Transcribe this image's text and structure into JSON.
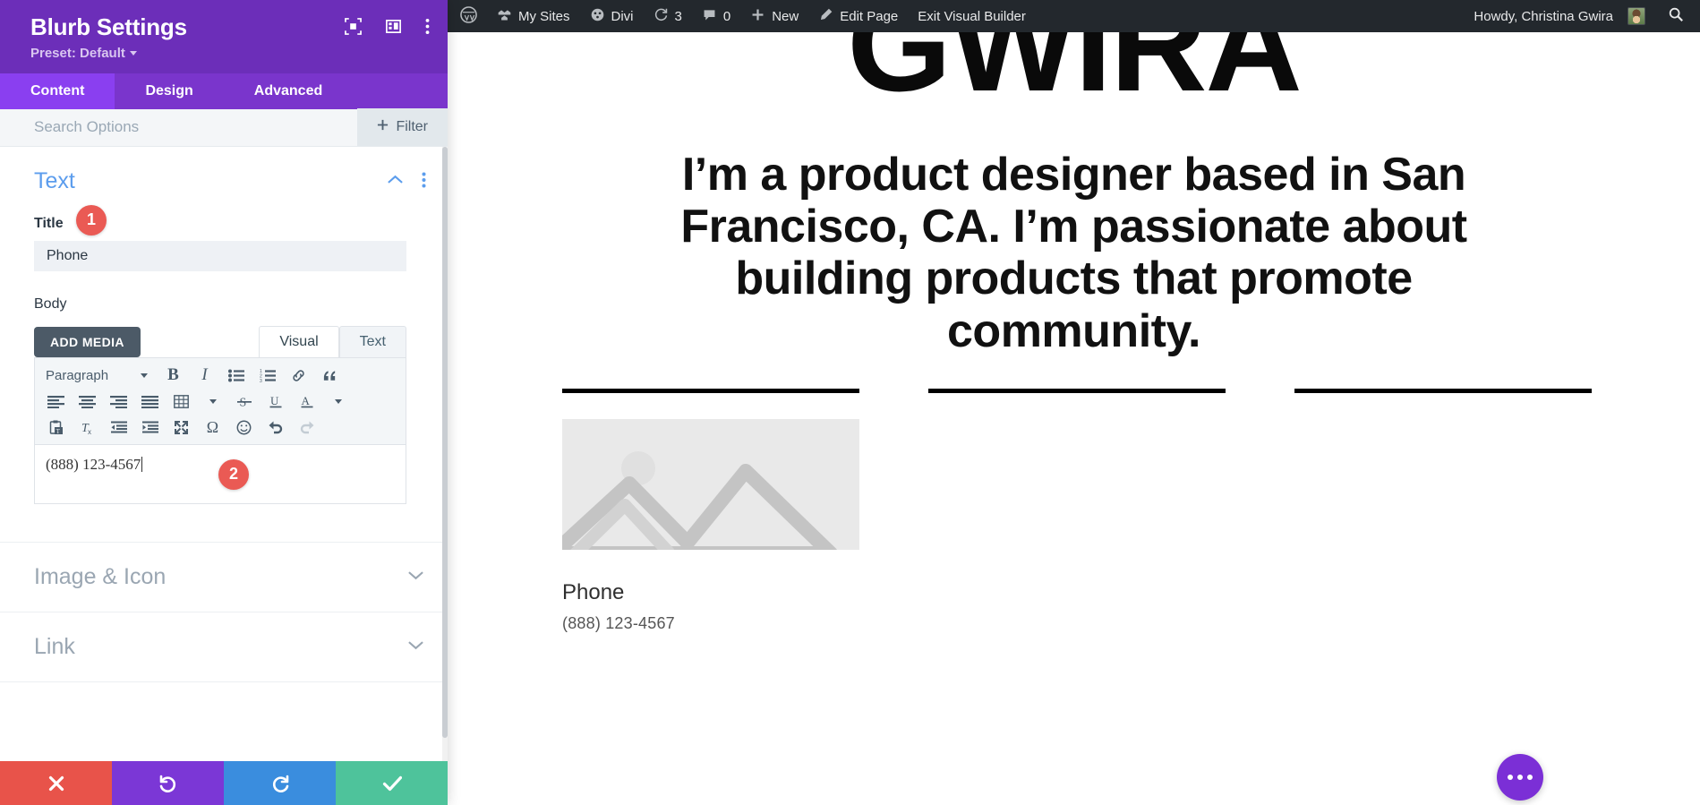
{
  "panel": {
    "title": "Blurb Settings",
    "preset_label": "Preset: Default",
    "header_icons": [
      {
        "name": "focus-target-icon"
      },
      {
        "name": "layout-columns-icon"
      },
      {
        "name": "vertical-dots-icon"
      }
    ],
    "tabs": [
      {
        "label": "Content",
        "active": true
      },
      {
        "label": "Design",
        "active": false
      },
      {
        "label": "Advanced",
        "active": false
      }
    ],
    "search": {
      "placeholder": "Search Options",
      "value": ""
    },
    "filter_button": "Filter",
    "section_text": {
      "title": "Text",
      "title_field": {
        "label": "Title",
        "value": "Phone",
        "callout": "1"
      },
      "body_field": {
        "label": "Body",
        "add_media_button": "ADD MEDIA",
        "editor_tabs": [
          {
            "label": "Visual",
            "active": true
          },
          {
            "label": "Text",
            "active": false
          }
        ],
        "toolbar_row1": [
          {
            "name": "paragraph-format-select",
            "label": "Paragraph"
          },
          {
            "name": "bold-icon",
            "label": "B"
          },
          {
            "name": "italic-icon",
            "label": "I"
          },
          {
            "name": "bullet-list-icon",
            "label": "☰"
          },
          {
            "name": "numbered-list-icon",
            "label": "☰"
          },
          {
            "name": "link-icon",
            "label": "🔗"
          },
          {
            "name": "blockquote-icon",
            "label": "“"
          }
        ],
        "toolbar_row2": [
          {
            "name": "align-left-icon"
          },
          {
            "name": "align-center-icon"
          },
          {
            "name": "align-right-icon"
          },
          {
            "name": "align-justify-icon"
          },
          {
            "name": "table-icon"
          },
          {
            "name": "strikethrough-icon",
            "label": "S"
          },
          {
            "name": "underline-icon",
            "label": "U"
          },
          {
            "name": "text-color-icon",
            "label": "A"
          }
        ],
        "toolbar_row3": [
          {
            "name": "paste-as-text-icon"
          },
          {
            "name": "clear-formatting-icon"
          },
          {
            "name": "outdent-icon"
          },
          {
            "name": "indent-icon"
          },
          {
            "name": "fullscreen-icon"
          },
          {
            "name": "special-character-icon",
            "label": "Ω"
          },
          {
            "name": "emoji-icon",
            "label": "☺"
          },
          {
            "name": "undo-icon"
          },
          {
            "name": "redo-icon"
          }
        ],
        "content_value": "(888) 123-4567",
        "callout": "2"
      }
    },
    "collapsed_sections": [
      {
        "label": "Image & Icon"
      },
      {
        "label": "Link"
      }
    ],
    "footer_buttons": [
      {
        "name": "cancel-button",
        "glyph": "✖",
        "color": "#e8534a"
      },
      {
        "name": "undo-button",
        "glyph": "↺",
        "color": "#7b37d6"
      },
      {
        "name": "redo-button",
        "glyph": "↻",
        "color": "#3a8dde"
      },
      {
        "name": "save-button",
        "glyph": "✔",
        "color": "#4ec39b"
      }
    ]
  },
  "admin_bar": {
    "items": [
      {
        "name": "wordpress-logo-icon",
        "label": ""
      },
      {
        "name": "my-sites-item",
        "label": "My Sites"
      },
      {
        "name": "divi-item",
        "label": "Divi"
      },
      {
        "name": "updates-item",
        "label": "3"
      },
      {
        "name": "comments-item",
        "label": "0"
      },
      {
        "name": "new-item",
        "label": "New"
      },
      {
        "name": "edit-page-item",
        "label": "Edit Page"
      },
      {
        "name": "exit-visual-builder-item",
        "label": "Exit Visual Builder"
      }
    ],
    "greeting": "Howdy, Christina Gwira",
    "search_icon": "search-icon"
  },
  "canvas": {
    "wordmark": "GWIRA",
    "intro": "I’m a product designer based in San Francisco, CA. I’m passionate about building products that promote community.",
    "blurbs": [
      {
        "title": "Phone",
        "body": "(888) 123-4567"
      },
      {
        "title": "",
        "body": ""
      },
      {
        "title": "",
        "body": ""
      }
    ],
    "fab": "more-options-button"
  },
  "colors": {
    "panel_header": "#6c2eb9",
    "tab_active": "#8a3ff0",
    "section_title": "#5c9ded",
    "callout": "#ea5a54",
    "admin_bar": "#23282d",
    "fab": "#7b2fd6"
  }
}
